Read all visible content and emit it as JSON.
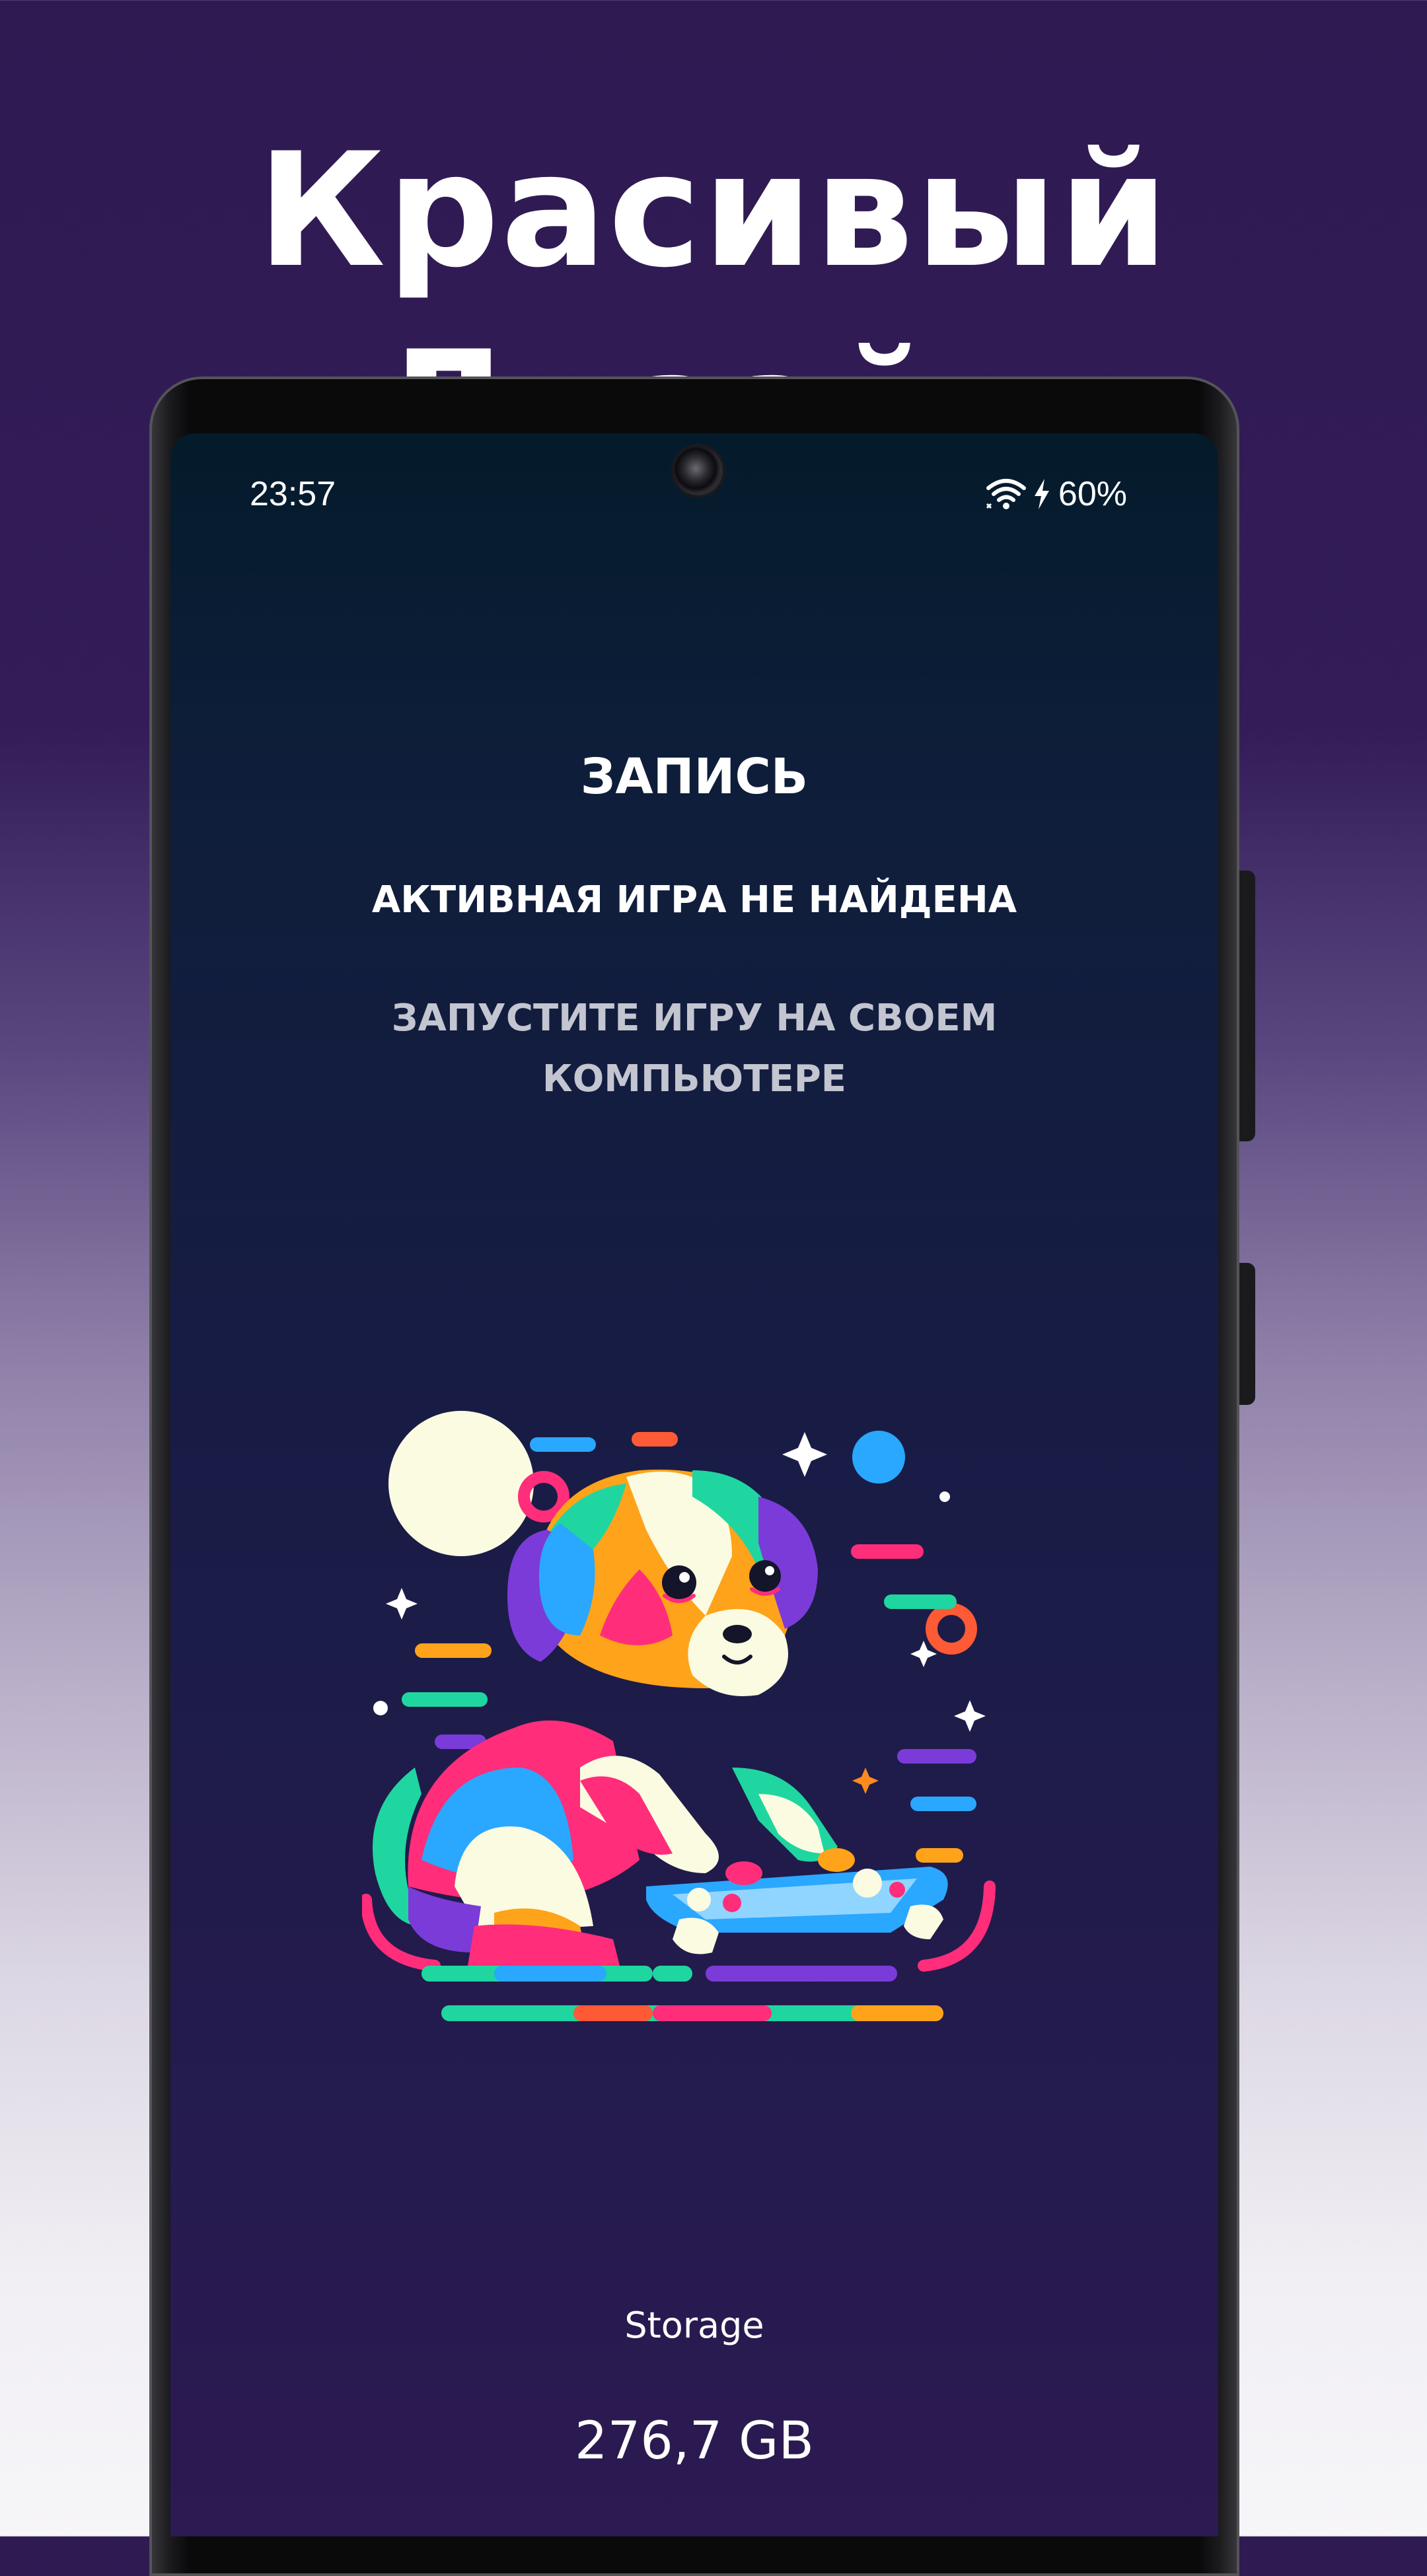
{
  "promo": {
    "headline": "Красивый Дизайн"
  },
  "status_bar": {
    "time": "23:57",
    "battery": "60%",
    "icons": [
      "wifi-icon",
      "charging-icon"
    ]
  },
  "recording": {
    "title": "ЗАПИСЬ",
    "status": "АКТИВНАЯ ИГРА НЕ НАЙДЕНА",
    "hint": "ЗАПУСТИТЕ ИГРУ НА СВОЕМ КОМПЬЮТЕРЕ"
  },
  "illustration": {
    "name": "puppy-gamer-illustration"
  },
  "storage": {
    "label": "Storage",
    "value": "276,7 GB"
  },
  "colors": {
    "page_top": "#2f1a52",
    "page_bottom": "#f6f5f8",
    "screen_top": "#041b2b",
    "screen_bottom": "#2c1a52",
    "hint_text": "#c3c5d0"
  }
}
